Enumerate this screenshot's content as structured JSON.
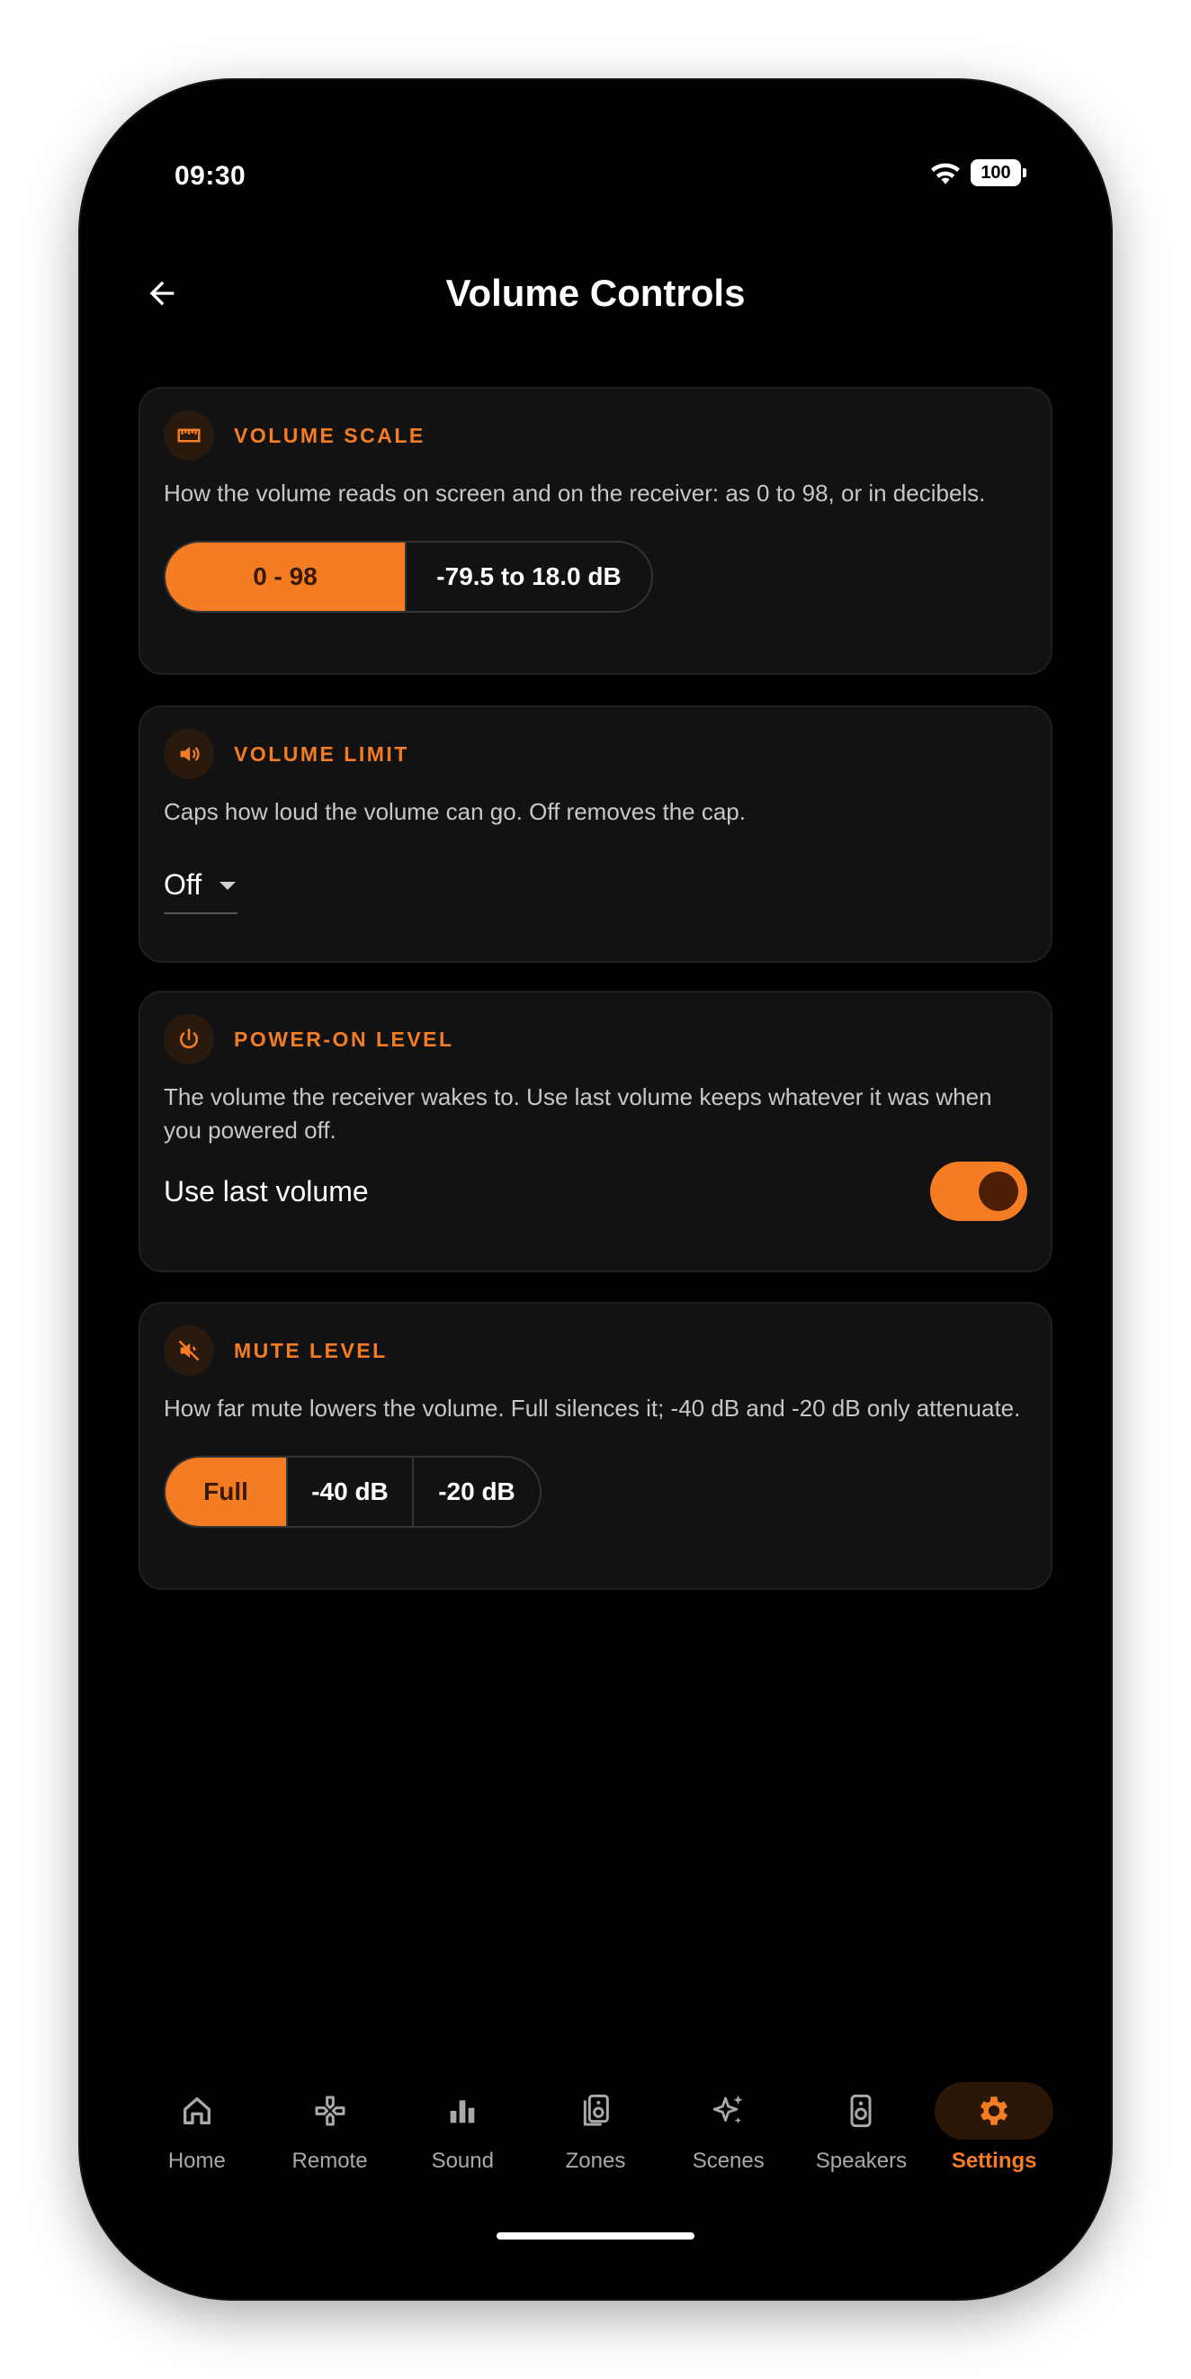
{
  "status_bar": {
    "time": "09:30",
    "battery": "100"
  },
  "header": {
    "title": "Volume Controls"
  },
  "volume_scale": {
    "title": "VOLUME SCALE",
    "description": "How the volume reads on screen and on the receiver: as 0 to 98, or in decibels.",
    "options": [
      "0 - 98",
      "-79.5 to 18.0 dB"
    ],
    "selected": "0 - 98"
  },
  "volume_limit": {
    "title": "VOLUME LIMIT",
    "description": "Caps how loud the volume can go. Off removes the cap.",
    "value": "Off"
  },
  "power_on_level": {
    "title": "POWER-ON LEVEL",
    "description": "The volume the receiver wakes to. Use last volume keeps whatever it was when you powered off.",
    "toggle_label": "Use last volume",
    "toggle_on": true
  },
  "mute_level": {
    "title": "MUTE LEVEL",
    "description": "How far mute lowers the volume. Full silences it; -40 dB and -20 dB only attenuate.",
    "options": [
      "Full",
      "-40 dB",
      "-20 dB"
    ],
    "selected": "Full"
  },
  "nav": {
    "items": [
      {
        "label": "Home",
        "icon": "home-icon"
      },
      {
        "label": "Remote",
        "icon": "gamepad-icon"
      },
      {
        "label": "Sound",
        "icon": "bars-icon"
      },
      {
        "label": "Zones",
        "icon": "speakers-icon"
      },
      {
        "label": "Scenes",
        "icon": "sparkle-icon"
      },
      {
        "label": "Speakers",
        "icon": "speaker-icon"
      },
      {
        "label": "Settings",
        "icon": "gear-icon"
      }
    ],
    "active": "Settings"
  },
  "colors": {
    "accent": "#f47d24",
    "background": "#000000",
    "card": "#121212"
  }
}
